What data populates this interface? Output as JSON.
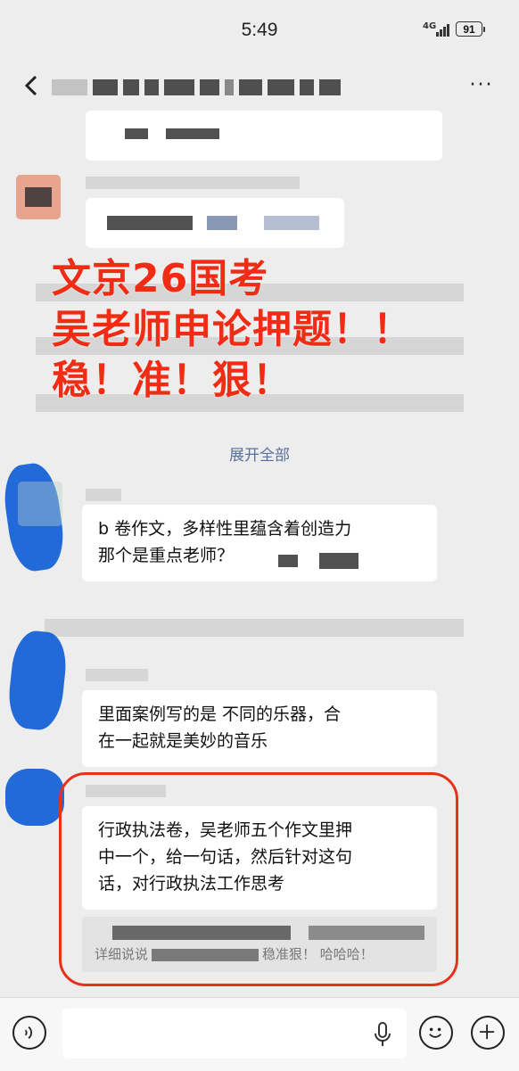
{
  "status_bar": {
    "time": "5:49",
    "network": "4G",
    "battery": "91"
  },
  "header": {
    "more_label": "···"
  },
  "overlay_promo": {
    "line1": "文京26国考",
    "line2": "吴老师申论押题！！",
    "line3": "稳！准！狠！",
    "color": "#f02c14"
  },
  "expand_all": "展开全部",
  "messages": [
    {
      "line1": "b 卷作文，多样性里蕴含着创造力",
      "line2": "那个是重点老师？"
    },
    {
      "line1": "里面案例写的是  不同的乐器，合",
      "line2": "在一起就是美妙的音乐"
    },
    {
      "line1": "行政执法卷，吴老师五个作文里押",
      "line2": "中一个，给一句话，然后针对这句",
      "line3": "话，对行政执法工作思考"
    }
  ],
  "quote": {
    "line2_prefix": "详细说说",
    "line2_suffix": "稳准狠！ 哈哈哈！"
  },
  "colors": {
    "accent_red": "#e8301a",
    "link_blue": "#57709c",
    "scribble_blue": "#1863d8"
  },
  "icons": [
    "back-icon",
    "more-icon",
    "voice-icon",
    "mic-icon",
    "emoji-icon",
    "plus-icon"
  ]
}
